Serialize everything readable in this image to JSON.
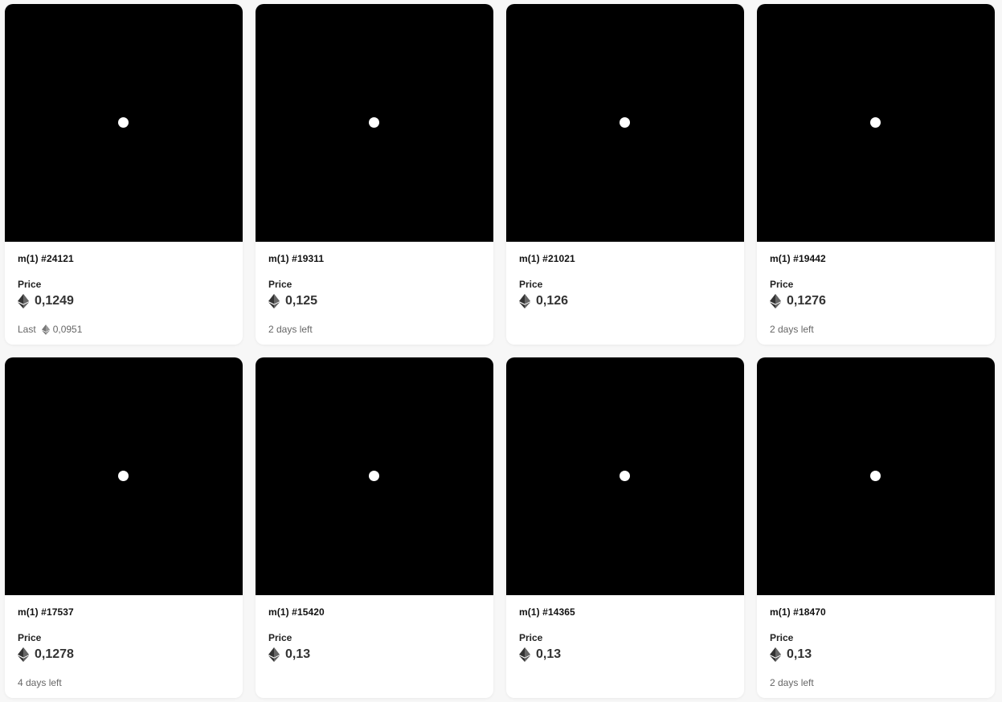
{
  "price_label": "Price",
  "icons": {
    "currency": "ethereum-icon"
  },
  "cards": [
    {
      "name": "m(1) #24121",
      "price": "0,1249",
      "footer_prefix": "Last",
      "footer_value": "0,0951",
      "footer_has_eth": true
    },
    {
      "name": "m(1) #19311",
      "price": "0,125",
      "footer_prefix": "2 days left",
      "footer_value": "",
      "footer_has_eth": false
    },
    {
      "name": "m(1) #21021",
      "price": "0,126",
      "footer_prefix": "",
      "footer_value": "",
      "footer_has_eth": false
    },
    {
      "name": "m(1) #19442",
      "price": "0,1276",
      "footer_prefix": "2 days left",
      "footer_value": "",
      "footer_has_eth": false
    },
    {
      "name": "m(1) #17537",
      "price": "0,1278",
      "footer_prefix": "4 days left",
      "footer_value": "",
      "footer_has_eth": false
    },
    {
      "name": "m(1) #15420",
      "price": "0,13",
      "footer_prefix": "",
      "footer_value": "",
      "footer_has_eth": false
    },
    {
      "name": "m(1) #14365",
      "price": "0,13",
      "footer_prefix": "",
      "footer_value": "",
      "footer_has_eth": false
    },
    {
      "name": "m(1) #18470",
      "price": "0,13",
      "footer_prefix": "2 days left",
      "footer_value": "",
      "footer_has_eth": false
    }
  ]
}
